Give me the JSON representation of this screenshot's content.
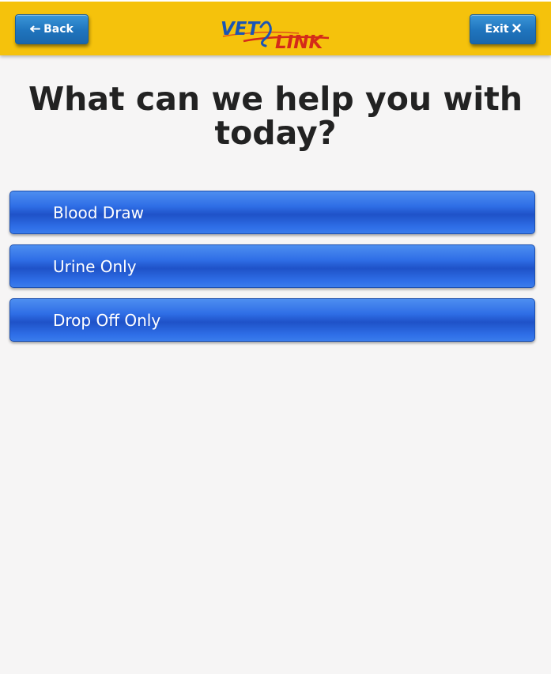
{
  "header": {
    "back_label": "Back",
    "exit_label": "Exit",
    "logo_text_left": "VET",
    "logo_text_right": "LINK"
  },
  "main": {
    "title": "What can we help you with today?",
    "options": [
      {
        "label": "Blood Draw"
      },
      {
        "label": "Urine Only"
      },
      {
        "label": "Drop Off Only"
      }
    ]
  },
  "colors": {
    "header_bg": "#f5c20c",
    "header_button": "#1f74bd",
    "option_button": "#2f6ee6",
    "logo_blue": "#1a55b5",
    "logo_red": "#d42a1a",
    "background": "#f6f5f5"
  },
  "icons": {
    "back": "arrow-left-icon",
    "exit": "close-icon",
    "logo": "vetlink-logo"
  }
}
